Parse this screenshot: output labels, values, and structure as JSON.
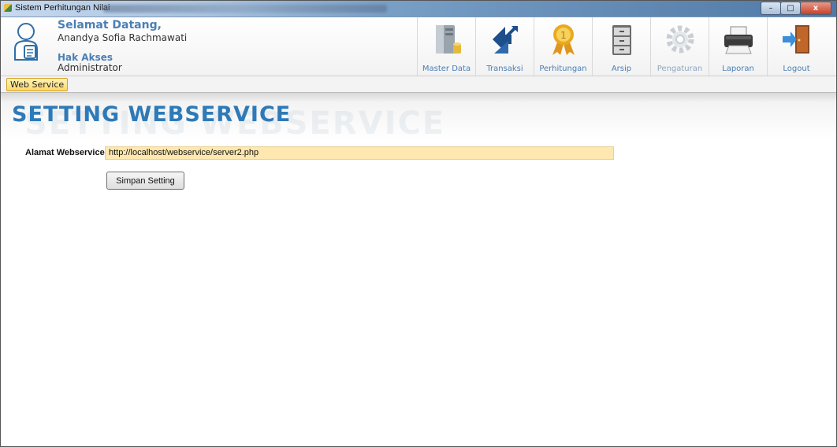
{
  "window": {
    "title": "Sistem Perhitungan Nilai",
    "controls": {
      "minimize": "–",
      "maximize": "□",
      "close": "x"
    }
  },
  "header": {
    "welcome_label": "Selamat Datang,",
    "user_name": "Anandya Sofia Rachmawati",
    "access_label": "Hak Akses",
    "access_value": "Administrator",
    "user_icon": "user-profile-icon"
  },
  "toolbar": {
    "items": [
      {
        "label": "Master Data",
        "icon": "database-server-icon"
      },
      {
        "label": "Transaksi",
        "icon": "transaction-arrows-icon"
      },
      {
        "label": "Perhitungan",
        "icon": "award-medal-icon"
      },
      {
        "label": "Arsip",
        "icon": "filing-cabinet-icon"
      },
      {
        "label": "Pengaturan",
        "icon": "gear-icon"
      },
      {
        "label": "Laporan",
        "icon": "printer-icon"
      },
      {
        "label": "Logout",
        "icon": "logout-door-icon"
      }
    ]
  },
  "tabs": {
    "active": "Web Service"
  },
  "page": {
    "heading": "SETTING WEBSERVICE",
    "heading_shadow": "SETTING WEBSERVICE",
    "field_label": "Alamat Webservice",
    "field_value": "http://localhost/webservice/server2.php",
    "save_button": "Simpan Setting"
  },
  "colors": {
    "accent_blue": "#2e7ab8",
    "label_blue": "#4a7fb5",
    "input_highlight": "#ffe8b0",
    "tab_active": "#ffd86a"
  }
}
